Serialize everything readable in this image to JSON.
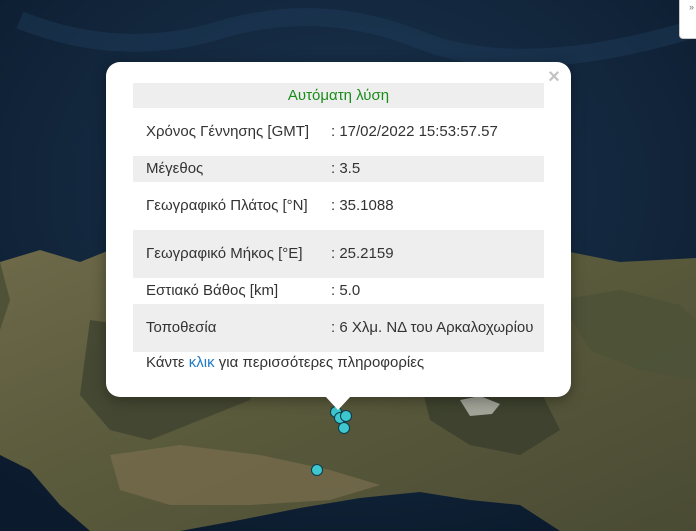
{
  "popup": {
    "title": "Αυτόματη λύση",
    "close_label": "×",
    "rows": [
      {
        "label": "Χρόνος Γέννησης [GMT]",
        "value": ": 17/02/2022 15:53:57.57"
      },
      {
        "label": "Μέγεθος",
        "value": ": 3.5"
      },
      {
        "label": "Γεωγραφικό Πλάτος [°N]",
        "value": ": 35.1088"
      },
      {
        "label": "Γεωγραφικό Μήκος [°E]",
        "value": ": 25.2159"
      },
      {
        "label": "Εστιακό Βάθος [km]",
        "value": ": 5.0"
      },
      {
        "label": "Τοποθεσία",
        "value": ": 6 Χλμ. ΝΔ του Αρκαλοχωρίου"
      }
    ],
    "more_prefix": "Κάντε ",
    "more_link": "κλικ",
    "more_suffix": " για περισσότερες πληροφορίες"
  },
  "map": {
    "corner_control_icon": "»",
    "marker_color": "#3ec7cf"
  }
}
